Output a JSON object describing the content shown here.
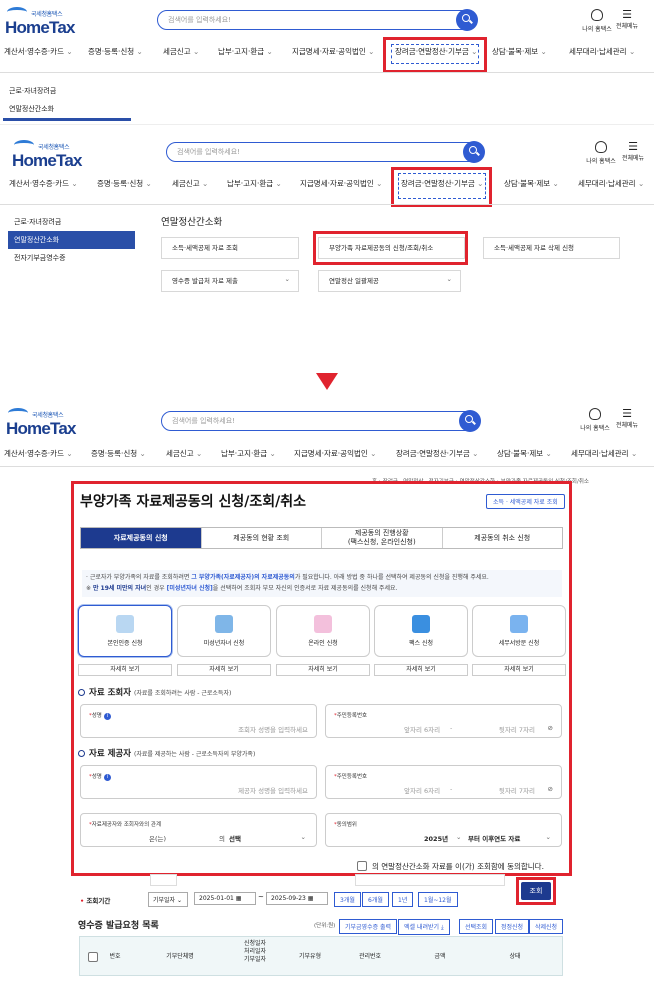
{
  "logo": {
    "small": "국세청홈택스",
    "big": "HomeTax"
  },
  "search": {
    "placeholder": "검색어를 입력하세요!"
  },
  "header": {
    "my_hometax": "나의 홈택스",
    "all_menu": "전체메뉴"
  },
  "menu": [
    "계산서·영수증·카드",
    "증명·등록·신청",
    "세금신고",
    "납부·고지·환급",
    "지급명세·자료·공익법인",
    "장려금·연말정산·기부금",
    "상담·불복·제보",
    "세무대리·납세관리"
  ],
  "submenu": {
    "items": [
      "근로·자녀장려금",
      "연말정산간소화",
      "전자기부금영수증"
    ]
  },
  "panel": {
    "title": "연말정산간소화",
    "tiles": [
      "소득·세액공제 자료 조회",
      "부양가족 자료제공동의 신청/조회/취소",
      "소득·세액공제 자료 삭제 신청",
      "영수증 발급처 자료 제출",
      "연말정산 일괄제공"
    ]
  },
  "breadcrumb": "홈 › 장려금 · 연말정산 · 전자기부금 › 연말정산간소화 › 부양가족 자료제공동의 신청/조회/취소",
  "page": {
    "title": "부양가족 자료제공동의 신청/조회/취소",
    "side_button": "소득 · 세액공제 자료 조회",
    "tabs": [
      "자료제공동의 신청",
      "제공동의 현황 조회",
      "제공동의 진행상황\n(팩스신청, 온라인신청)",
      "제공동의 취소 신청"
    ],
    "notice1_a": "· 근로자가 부양가족의 자료를 조회하려면 ",
    "notice1_b": "그 부양가족(자료제공자)의 자료제공동의",
    "notice1_c": "가 필요합니다. 아래 방법 중 하나를 선택하여 제공동의 신청을 진행해 주세요.",
    "notice2_a": "※ ",
    "notice2_b": "만 19세 미만의 자녀",
    "notice2_c": "인 경우 ",
    "notice2_d": "[미성년자녀 신청]",
    "notice2_e": "을 선택하여 조회자 부모 자신의 인증서로 자료 제공동의를 신청해 주세요.",
    "methods": [
      "본인인증 신청",
      "미성년자녀 신청",
      "온라인 신청",
      "팩스 신청",
      "세무서방문 신청"
    ],
    "detail_label": "자세히 보기"
  },
  "viewer": {
    "section": "자료 조회자",
    "section_note": "(자료를 조회하려는 사람 - 근로소득자)",
    "name_label": "성명",
    "name_ph": "조회자 성명을 입력하세요",
    "rrn_label": "주민등록번호",
    "rrn_front_ph": "앞자리 6자리",
    "rrn_back_ph": "뒷자리 7자리"
  },
  "provider": {
    "section": "자료 제공자",
    "section_note": "(자료를 제공하는 사람 - 근로소득자의 부양가족)",
    "name_label": "성명",
    "name_ph": "제공자 성명을 입력하세요",
    "rrn_label": "주민등록번호",
    "rrn_front_ph": "앞자리 6자리",
    "rrn_back_ph": "뒷자리 7자리"
  },
  "relation": {
    "label": "자료제공자와 조회자와의 관계",
    "left": "은(는)",
    "mid": "의",
    "select": "선택",
    "scope_label": "동의범위",
    "year": "2025년",
    "range": "부터 이후연도 자료"
  },
  "agree": "의 연말정산간소화 자료를 이(가) 조회함에 동의합니다.",
  "period": {
    "label": "조회기간",
    "type": "기부일자",
    "from": "2025-01-01",
    "to": "2025-09-23",
    "quick": [
      "3개월",
      "6개월",
      "1년",
      "1월~12월"
    ],
    "search_btn": "조회"
  },
  "list": {
    "title": "영수증 발급요청 목록",
    "unit": "(단위:원)",
    "buttons": [
      "기부금영수증 출력",
      "엑셀 내려받기",
      "선택조회",
      "정정신청",
      "삭제신청"
    ],
    "headers": [
      "번호",
      "기부단체명",
      "신청일자\n처리일자\n기부일자",
      "기부유형",
      "관리번호",
      "금액",
      "상태"
    ]
  }
}
